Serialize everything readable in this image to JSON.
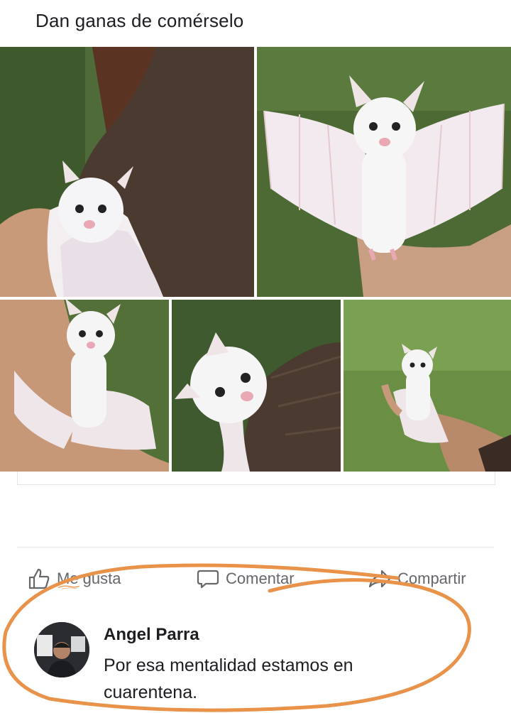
{
  "post": {
    "text": "Dan ganas de comérselo",
    "photos": [
      {
        "name": "photo-bat-on-shoulder"
      },
      {
        "name": "photo-bat-wings-spread"
      },
      {
        "name": "photo-bat-on-arm"
      },
      {
        "name": "photo-bat-closeup"
      },
      {
        "name": "photo-bat-in-hand"
      }
    ]
  },
  "actions": {
    "like_label": "Me gusta",
    "comment_label": "Comentar",
    "share_label": "Compartir",
    "like_icon": "thumbs-up-icon",
    "comment_icon": "speech-bubble-icon",
    "share_icon": "share-arrow-icon"
  },
  "comment": {
    "author": "Angel Parra",
    "text": "Por esa mentalidad estamos en cuarentena."
  },
  "colors": {
    "highlight": "#e8924a",
    "action_text": "#65676b"
  }
}
